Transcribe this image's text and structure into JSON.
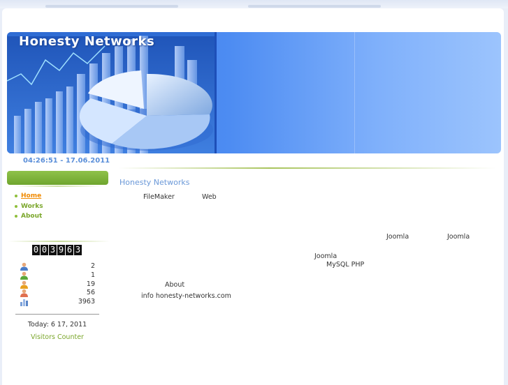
{
  "header": {
    "site_title": "Honesty Networks",
    "datetime": "04:26:51 - 17.06.2011"
  },
  "nav": {
    "items": [
      {
        "label": "Home",
        "active": true
      },
      {
        "label": "Works"
      },
      {
        "label": "About"
      }
    ]
  },
  "counter": {
    "digits": [
      "0",
      "0",
      "3",
      "9",
      "6",
      "3"
    ],
    "stats": [
      {
        "icon": "single-user-icon",
        "value": "2"
      },
      {
        "icon": "green-user-icon",
        "value": "1"
      },
      {
        "icon": "orange-user-icon",
        "value": "19"
      },
      {
        "icon": "red-user-icon",
        "value": "56"
      },
      {
        "icon": "bar-chart-icon",
        "value": "3963"
      }
    ],
    "today": "Today: 6  17, 2011",
    "label": "Visitors Counter"
  },
  "main": {
    "heading": "Honesty Networks",
    "words": {
      "filemaker": "FileMaker",
      "web": "Web",
      "joomla1": "Joomla",
      "joomla2": "Joomla",
      "joomla3": "Joomla",
      "mysql_php": "MySQL PHP",
      "about": "About",
      "email": "info honesty-networks.com"
    }
  },
  "colors": {
    "accent_green": "#7aa62a",
    "active_orange": "#f08a00",
    "heading_blue": "#6a98d8",
    "banner_blue": "#2a6be0"
  }
}
